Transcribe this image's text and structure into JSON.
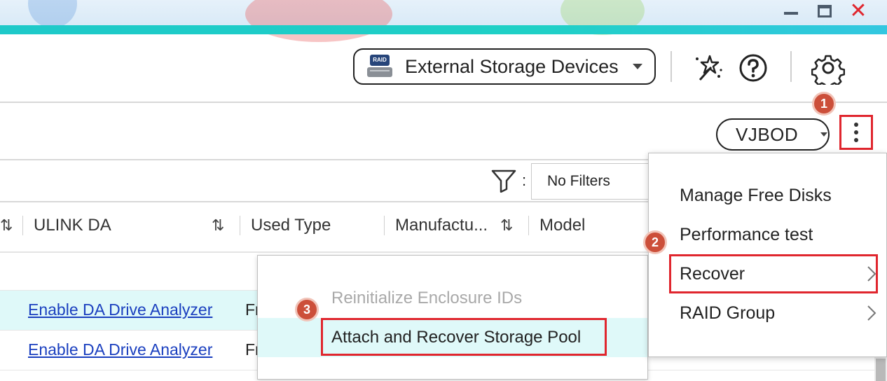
{
  "window": {
    "controls": {
      "minimize": "minimize",
      "maximize": "maximize",
      "close": "✕"
    }
  },
  "header": {
    "storage_button_label": "External Storage Devices",
    "hdd_icon_text": "RAID",
    "icons": [
      "magic-wand-icon",
      "help-icon",
      "gear-icon"
    ]
  },
  "toolbar": {
    "enclosure_select": "VJBOD",
    "filter_separator": ":",
    "filter_value": "No Filters"
  },
  "columns": [
    "ULINK DA",
    "Used Type",
    "Manufactu...",
    "Model"
  ],
  "rows": [
    {
      "link": "Enable DA Drive Analyzer",
      "next_cell": "Fr"
    },
    {
      "link": "Enable DA Drive Analyzer",
      "next_cell": "Fr"
    }
  ],
  "menu": {
    "items": [
      "Manage Free Disks",
      "Performance test",
      "Recover",
      "RAID Group"
    ]
  },
  "submenu": {
    "items": [
      "Reinitialize Enclosure IDs",
      "Attach and Recover Storage Pool"
    ]
  },
  "badges": [
    "1",
    "2",
    "3"
  ],
  "colors": {
    "accent": "#1ec9c9",
    "highlight_red": "#e0262e",
    "badge": "#cc4f3a",
    "link": "#1a3fbf",
    "row_highlight": "#dff9f9"
  }
}
